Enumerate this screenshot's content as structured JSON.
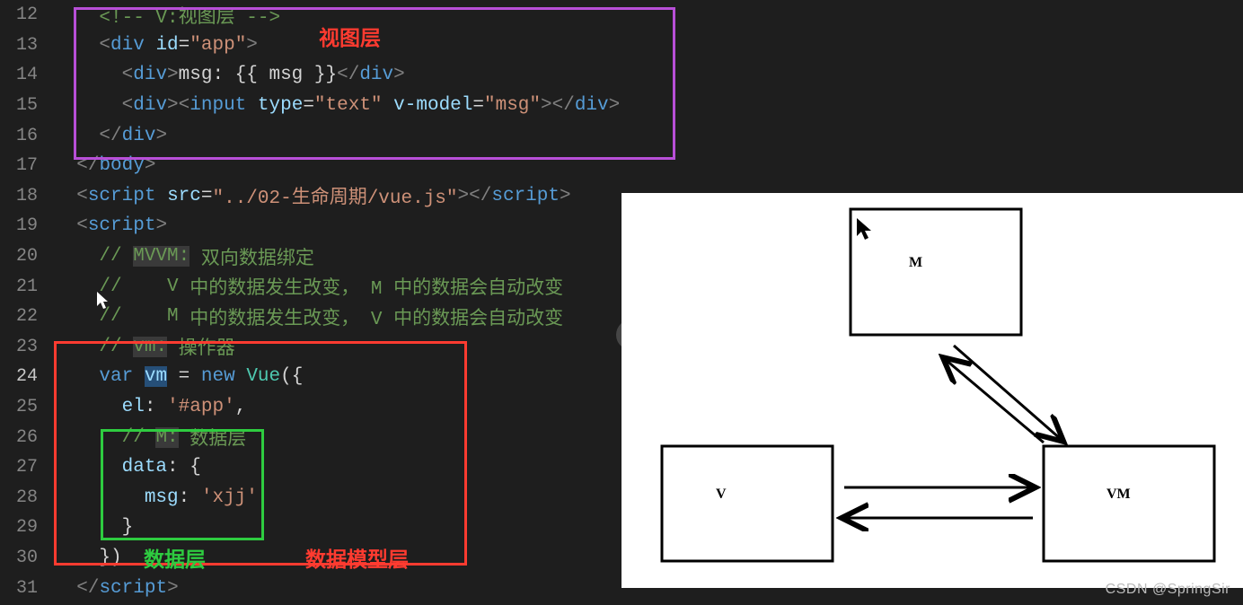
{
  "watermark": "CSDN @SpringSir",
  "annotations": {
    "view_layer": "视图层",
    "data_layer": "数据层",
    "data_model_layer": "数据模型层"
  },
  "diagram": {
    "boxes": {
      "m": "M",
      "v": "V",
      "vm": "VM"
    }
  },
  "gutter": [
    "12",
    "13",
    "14",
    "15",
    "16",
    "17",
    "18",
    "19",
    "20",
    "21",
    "22",
    "23",
    "24",
    "25",
    "26",
    "27",
    "28",
    "29",
    "30",
    "31"
  ],
  "code": {
    "l12": {
      "indent": "    ",
      "cmt": "<!-- V:视图层 -->"
    },
    "l13": {
      "indent": "    ",
      "lt": "<",
      "tag": "div",
      "sp": " ",
      "attr": "id",
      "eq": "=",
      "val": "\"app\"",
      "gt": ">"
    },
    "l14": {
      "indent": "      ",
      "lt": "<",
      "tag": "div",
      "gt": ">",
      "txt": "msg: {{ msg }}",
      "clt": "</",
      "ctag": "div",
      "cgt": ">"
    },
    "l15": {
      "indent": "      ",
      "lt": "<",
      "tag": "div",
      "gt": ">",
      "ilt": "<",
      "itag": "input",
      "sp1": " ",
      "attr1": "type",
      "eq1": "=",
      "val1": "\"text\"",
      "sp2": " ",
      "attr2": "v-model",
      "eq2": "=",
      "val2": "\"msg\"",
      "igt": ">",
      "clt": "</",
      "ctag": "div",
      "cgt": ">"
    },
    "l16": {
      "indent": "    ",
      "clt": "</",
      "tag": "div",
      "gt": ">"
    },
    "l17": {
      "indent": "  ",
      "clt": "</",
      "tag": "body",
      "gt": ">"
    },
    "l18": {
      "indent": "  ",
      "lt": "<",
      "tag": "script",
      "sp": " ",
      "attr": "src",
      "eq": "=",
      "val": "\"../02-生命周期/vue.js\"",
      "gt": ">",
      "clt": "</",
      "ctag": "script",
      "cgt": ">"
    },
    "l19": {
      "indent": "  ",
      "lt": "<",
      "tag": "script",
      "gt": ">"
    },
    "l20": {
      "indent": "    ",
      "slash": "// ",
      "kw": "MVVM:",
      "rest": " 双向数据绑定"
    },
    "l21": {
      "indent": "    ",
      "slash": "//    ",
      "kw": "V",
      "rest": " 中的数据发生改变， M 中的数据会自动改变"
    },
    "l22": {
      "indent": "    ",
      "slash": "//    ",
      "kw": "M",
      "rest": " 中的数据发生改变， V 中的数据会自动改变"
    },
    "l23": {
      "indent": "    ",
      "slash": "// ",
      "kw": "vm:",
      "rest": " 操作器"
    },
    "l24": {
      "indent": "    ",
      "var_kw": "var",
      "sp1": " ",
      "ident": "vm",
      "sp2": " ",
      "eq": "=",
      "sp3": " ",
      "new_kw": "new",
      "sp4": " ",
      "cls": "Vue",
      "paren": "({"
    },
    "l25": {
      "indent": "      ",
      "key": "el",
      "colon": ": ",
      "val": "'#app'",
      "comma": ","
    },
    "l26": {
      "indent": "      ",
      "slash": "// ",
      "kw": "M:",
      "rest": " 数据层"
    },
    "l27": {
      "indent": "      ",
      "key": "data",
      "colon": ": ",
      "brace": "{"
    },
    "l28": {
      "indent": "        ",
      "key": "msg",
      "colon": ": ",
      "val": "'xjj'"
    },
    "l29": {
      "indent": "      ",
      "brace": "}"
    },
    "l30": {
      "indent": "    ",
      "close": "})"
    },
    "l31": {
      "indent": "  ",
      "clt": "</",
      "tag": "script",
      "gt": ">"
    }
  }
}
